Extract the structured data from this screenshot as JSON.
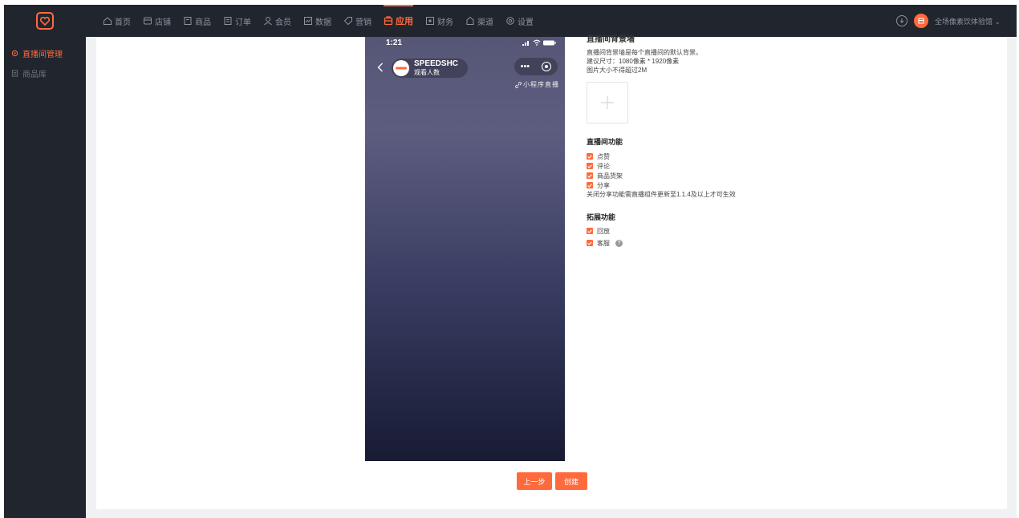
{
  "brand": {
    "accent": "#ff6a3d",
    "dark_bg": "#21252e"
  },
  "nav": [
    {
      "label": "首页",
      "icon": "home-icon"
    },
    {
      "label": "店铺",
      "icon": "store-icon"
    },
    {
      "label": "商品",
      "icon": "product-icon"
    },
    {
      "label": "订单",
      "icon": "order-icon"
    },
    {
      "label": "会员",
      "icon": "member-icon"
    },
    {
      "label": "数据",
      "icon": "chart-icon"
    },
    {
      "label": "营销",
      "icon": "tag-icon"
    },
    {
      "label": "应用",
      "icon": "app-icon",
      "active": true
    },
    {
      "label": "财务",
      "icon": "finance-icon"
    },
    {
      "label": "渠道",
      "icon": "channel-icon"
    },
    {
      "label": "设置",
      "icon": "gear-icon"
    }
  ],
  "header": {
    "store_name": "全场像素饮体验馆 ⌄"
  },
  "sidebar": [
    {
      "label": "直播间管理",
      "active": true
    },
    {
      "label": "商品库",
      "active": false
    }
  ],
  "phone": {
    "time": "1:21",
    "anchor_name": "SPEEDSHC",
    "anchor_sub": "观看人数",
    "capsule_dots": "•••",
    "mini_live": "小程序直播"
  },
  "form": {
    "clip_title": "直播间背景墙",
    "background_hints": [
      "直播间背景墙是每个直播间的默认背景。",
      "建议尺寸：1080像素 * 1920像素",
      "图片大小不得超过2M"
    ],
    "features_title": "直播间功能",
    "features": [
      "点赞",
      "评论",
      "商品货架",
      "分享"
    ],
    "share_note": "关闭分享功能需直播组件更新至1.1.4及以上才可生效",
    "extended_title": "拓展功能",
    "extended": [
      "回放",
      "客服"
    ],
    "help_glyph": "?"
  },
  "buttons": {
    "prev": "上一步",
    "create": "创建"
  }
}
